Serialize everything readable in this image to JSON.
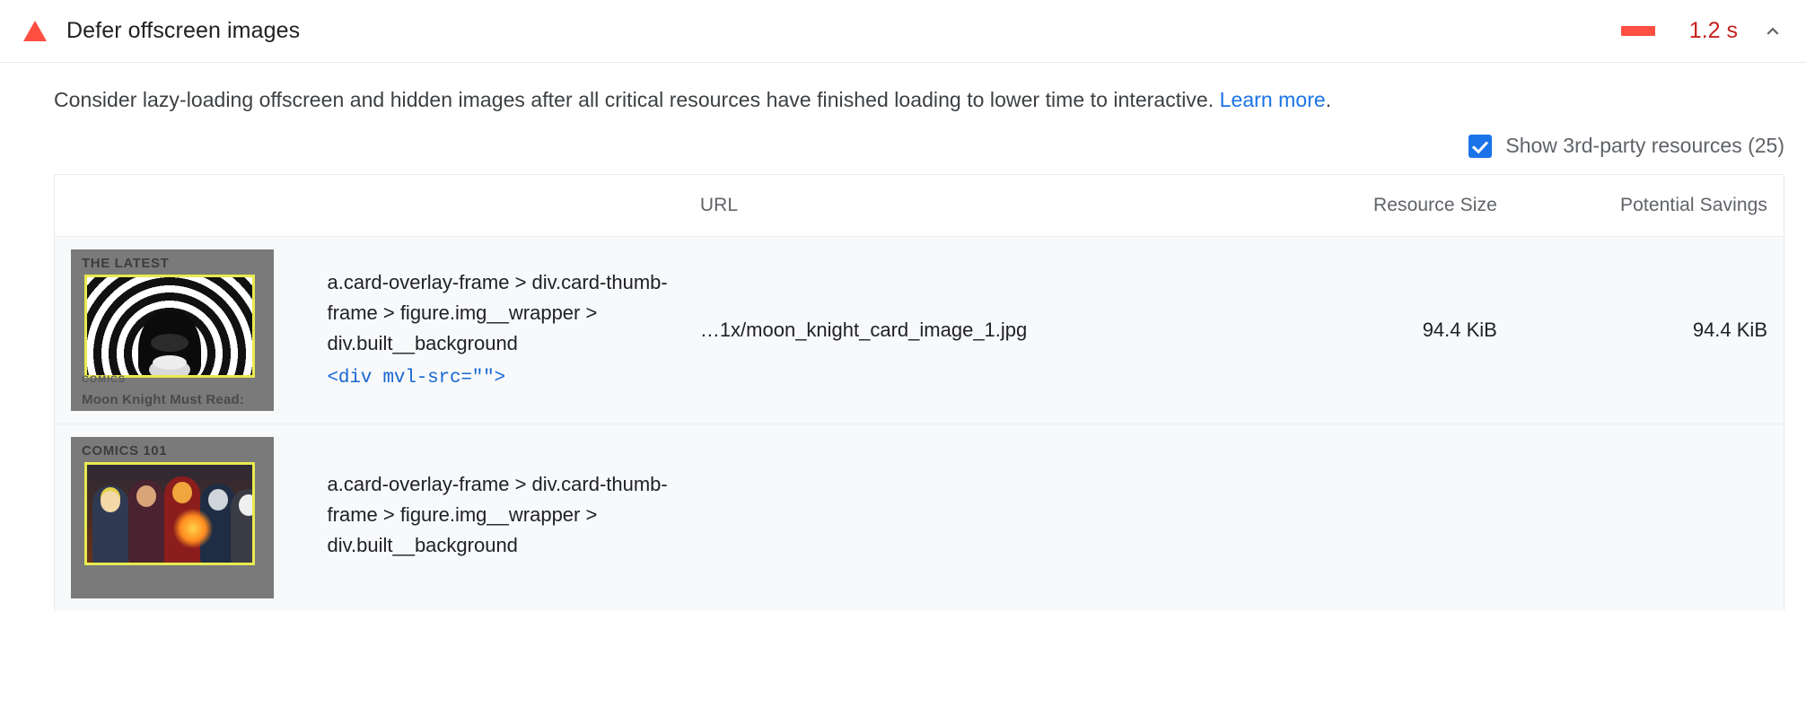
{
  "audit": {
    "title": "Defer offscreen images",
    "icon": "warning-triangle-icon",
    "value": "1.2 s",
    "value_color": "#c5221f",
    "sparkbar_color": "#ff4e42",
    "expanded": true,
    "toggle_icon": "chevron-up-icon",
    "description_before": "Consider lazy-loading offscreen and hidden images after all critical resources have finished loading to lower time to interactive. ",
    "learn_more_label": "Learn more",
    "description_after": "."
  },
  "filter": {
    "label": "Show 3rd-party resources (25)",
    "checked": true,
    "accent": "#1a73e8"
  },
  "table": {
    "headers": {
      "thumbnail": "",
      "node": "",
      "url": "URL",
      "resource_size": "Resource Size",
      "potential_savings": "Potential Savings"
    },
    "rows": [
      {
        "thumbnail": {
          "kicker": "THE LATEST",
          "category": "COMICS",
          "caption": "Moon Knight Must Read:",
          "art": "moon-knight"
        },
        "node_selector": "a.card-overlay-frame > div.card-thumb-frame > figure.img__wrapper > div.built__background",
        "node_snippet": "<div mvl-src=\"\">",
        "url": "…1x/moon_knight_card_image_1.jpg",
        "resource_size": "94.4 KiB",
        "potential_savings": "94.4 KiB"
      },
      {
        "thumbnail": {
          "kicker": "COMICS 101",
          "category": "",
          "caption": "",
          "art": "group"
        },
        "node_selector": "a.card-overlay-frame > div.card-thumb-frame > figure.img__wrapper > div.built__background",
        "node_snippet": "",
        "url": "",
        "resource_size": "",
        "potential_savings": ""
      }
    ]
  }
}
